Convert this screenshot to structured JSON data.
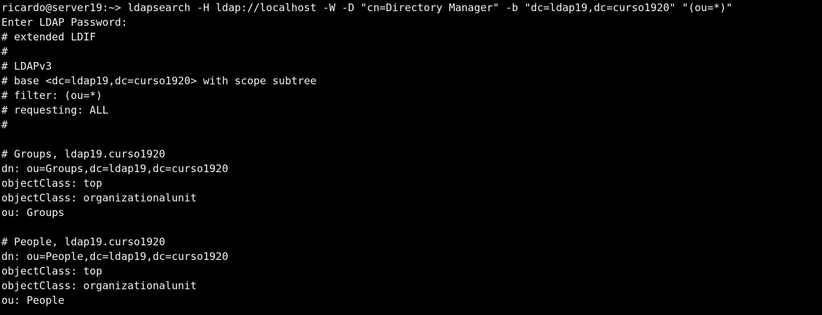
{
  "terminal": {
    "prompt": "ricardo@server19:~>",
    "command": " ldapsearch -H ldap://localhost -W -D \"cn=Directory Manager\" -b \"dc=ldap19,dc=curso1920\" \"(ou=*)\"",
    "password_prompt": "Enter LDAP Password:",
    "header": [
      "# extended LDIF",
      "#",
      "# LDAPv3",
      "# base <dc=ldap19,dc=curso1920> with scope subtree",
      "# filter: (ou=*)",
      "# requesting: ALL",
      "#"
    ],
    "entries": [
      {
        "comment": "# Groups, ldap19.curso1920",
        "dn": "dn: ou=Groups,dc=ldap19,dc=curso1920",
        "objectclass_1": "objectClass: top",
        "objectclass_2": "objectClass: organizationalunit",
        "ou": "ou: Groups"
      },
      {
        "comment": "# People, ldap19.curso1920",
        "dn": "dn: ou=People,dc=ldap19,dc=curso1920",
        "objectclass_1": "objectClass: top",
        "objectclass_2": "objectClass: organizationalunit",
        "ou": "ou: People"
      }
    ]
  },
  "colors": {
    "background": "#000000",
    "foreground": "#f2f2f2"
  }
}
